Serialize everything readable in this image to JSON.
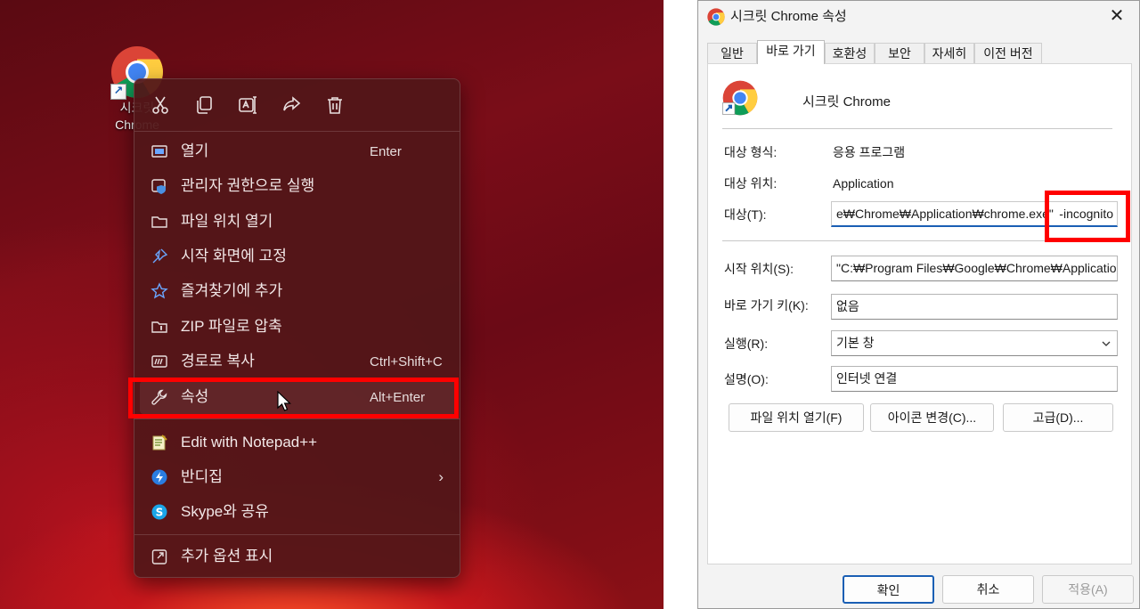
{
  "desktop": {
    "icon_label": "시크릿 Chrome",
    "shortcut_glyph": "↗"
  },
  "context_menu": {
    "toolbar": [
      {
        "name": "cut-icon"
      },
      {
        "name": "copy-icon"
      },
      {
        "name": "rename-icon"
      },
      {
        "name": "share-icon"
      },
      {
        "name": "delete-icon"
      }
    ],
    "items": [
      {
        "label": "열기",
        "shortcut": "Enter",
        "icon": "open-icon"
      },
      {
        "label": "관리자 권한으로 실행",
        "shortcut": "",
        "icon": "admin-shield-icon"
      },
      {
        "label": "파일 위치 열기",
        "shortcut": "",
        "icon": "folder-icon"
      },
      {
        "label": "시작 화면에 고정",
        "shortcut": "",
        "icon": "pin-icon"
      },
      {
        "label": "즐겨찾기에 추가",
        "shortcut": "",
        "icon": "star-icon"
      },
      {
        "label": "ZIP 파일로 압축",
        "shortcut": "",
        "icon": "zip-icon"
      },
      {
        "label": "경로로 복사",
        "shortcut": "Ctrl+Shift+C",
        "icon": "copy-path-icon"
      },
      {
        "label": "속성",
        "shortcut": "Alt+Enter",
        "icon": "wrench-icon"
      },
      {
        "label": "Edit with Notepad++",
        "shortcut": "",
        "icon": "notepad-plus-plus-icon"
      },
      {
        "label": "반디집",
        "shortcut": "",
        "icon": "bandizip-icon",
        "submenu_arrow": "›"
      },
      {
        "label": "Skype와 공유",
        "shortcut": "",
        "icon": "skype-icon"
      },
      {
        "label": "추가 옵션 표시",
        "shortcut": "",
        "icon": "more-options-icon"
      }
    ]
  },
  "dialog": {
    "title": "시크릿 Chrome 속성",
    "close_glyph": "✕",
    "tabs": [
      "일반",
      "바로 가기",
      "호환성",
      "보안",
      "자세히",
      "이전 버전"
    ],
    "active_tab": "바로 가기",
    "shortcut_name": "시크릿 Chrome",
    "rows": {
      "target_type": {
        "label": "대상 형식:",
        "value": "응용 프로그램"
      },
      "target_location": {
        "label": "대상 위치:",
        "value": "Application"
      },
      "target": {
        "label": "대상(T):",
        "value": "e₩Chrome₩Application₩chrome.exe\"",
        "value_suffix": "-incognito"
      },
      "start_in": {
        "label": "시작 위치(S):",
        "value": "\"C:₩Program Files₩Google₩Chrome₩Application"
      },
      "shortcut_key": {
        "label": "바로 가기 키(K):",
        "value": "없음"
      },
      "run": {
        "label": "실행(R):",
        "value": "기본 창"
      },
      "comment": {
        "label": "설명(O):",
        "value": "인터넷 연결"
      }
    },
    "action_buttons": {
      "open_location": "파일 위치 열기(F)",
      "change_icon": "아이콘 변경(C)...",
      "advanced": "고급(D)..."
    },
    "footer": {
      "ok": "확인",
      "cancel": "취소",
      "apply": "적용(A)"
    }
  },
  "colors": {
    "highlight": "#ff0000",
    "accent": "#1a5fb4",
    "menu_bg": "#521618"
  }
}
